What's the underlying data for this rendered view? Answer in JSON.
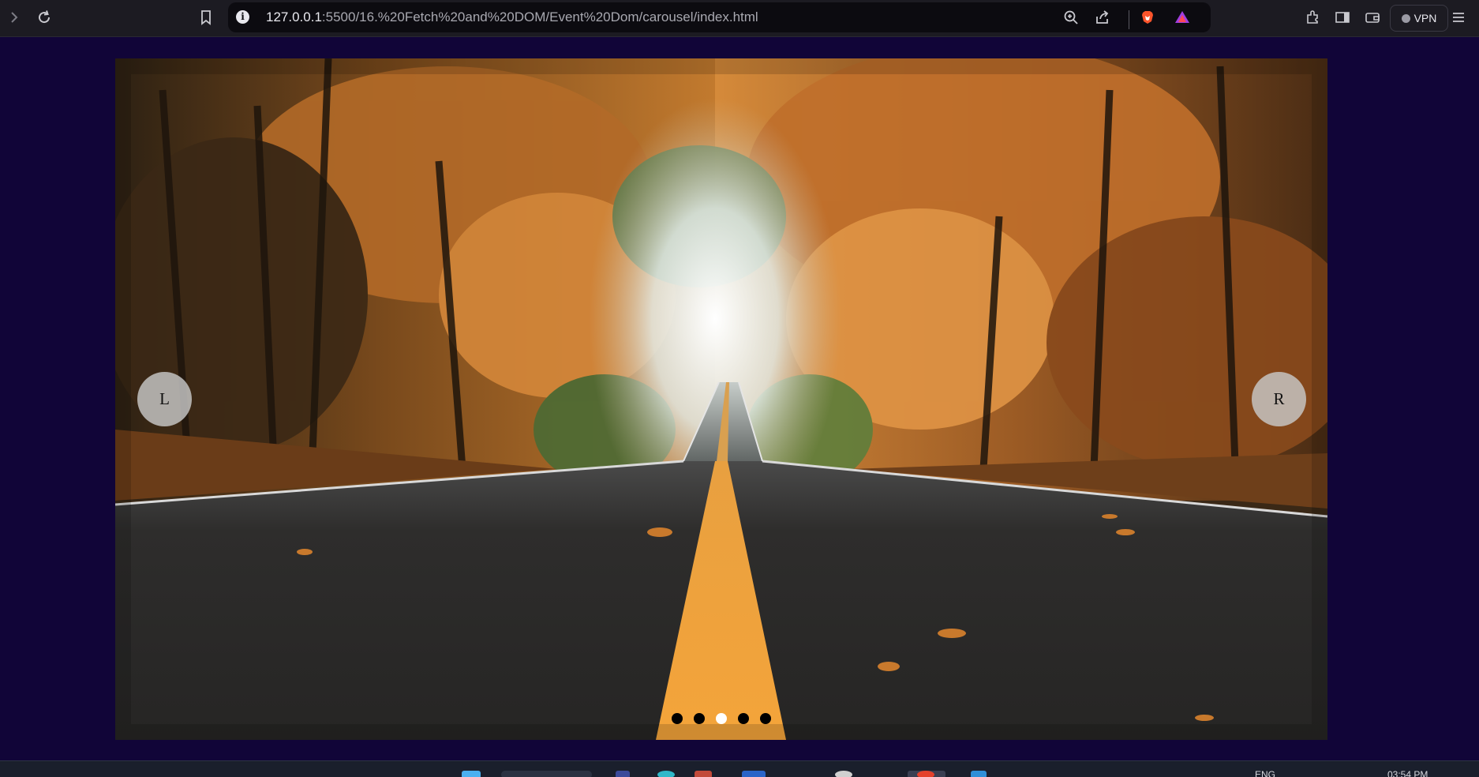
{
  "browser": {
    "url_host": "127.0.0.1",
    "url_path": ":5500/16.%20Fetch%20and%20DOM/Event%20Dom/carousel/index.html",
    "vpn_label": "VPN",
    "icons": [
      "forward-icon",
      "reload-icon",
      "bookmark-icon",
      "site-info-icon",
      "zoom-icon",
      "share-icon",
      "brave-shields-icon",
      "brave-rewards-icon",
      "extensions-icon",
      "sidebar-icon",
      "wallet-icon",
      "menu-icon"
    ]
  },
  "carousel": {
    "prev_label": "L",
    "next_label": "R",
    "slide_count": 5,
    "active_slide_index": 3,
    "slide_description_icon": "autumn-road-photo"
  },
  "taskbar": {
    "lang": "ENG",
    "time": "03:54 PM"
  },
  "colors": {
    "page_background": "#110538",
    "nav_button": "#c8c8c8",
    "dot_inactive": "#000000",
    "dot_active": "#ffffff"
  }
}
